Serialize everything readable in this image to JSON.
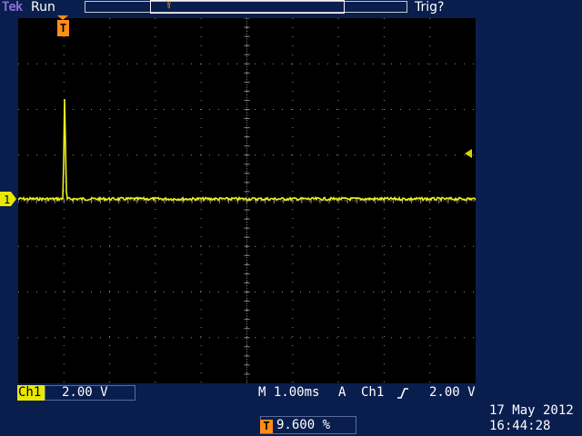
{
  "top_bar": {
    "brand": "Tek",
    "acquisition_state": "Run",
    "trigger_state": "Trig?",
    "record_marker": "ℽ"
  },
  "screen": {
    "trigger_marker_label": "T",
    "channel_marker_label": "1",
    "trace_color": "#f0f020",
    "grid_color": "#8a8a8a"
  },
  "channel": {
    "label": "Ch1",
    "scale": "2.00 V"
  },
  "timebase": "M 1.00ms",
  "trigger": {
    "mode": "A",
    "source": "Ch1",
    "level": "2.00 V",
    "position_badge": "T",
    "position_percent": "9.600 %"
  },
  "datetime": {
    "date": "17 May 2012",
    "time": "16:44:28"
  }
}
